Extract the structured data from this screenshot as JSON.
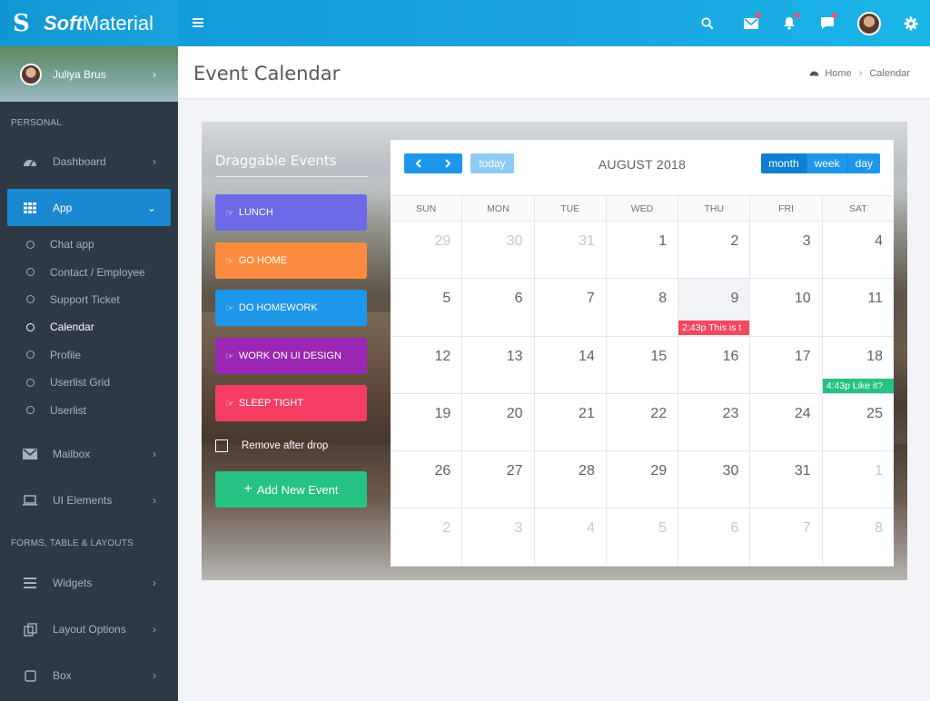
{
  "app": {
    "brand_bold": "Soft",
    "brand_rest": "Material"
  },
  "user": {
    "name": "Juliya Brus"
  },
  "sidebar": {
    "section_personal": "PERSONAL",
    "section_forms": "FORMS, TABLE & LAYOUTS",
    "items": {
      "dashboard": "Dashboard",
      "app": "App",
      "mailbox": "Mailbox",
      "ui_elements": "UI Elements",
      "widgets": "Widgets",
      "layout_options": "Layout Options",
      "box": "Box"
    },
    "app_sub": [
      "Chat app",
      "Contact / Employee",
      "Support Ticket",
      "Calendar",
      "Profile",
      "Userlist Grid",
      "Userlist"
    ]
  },
  "page": {
    "title": "Event Calendar",
    "breadcrumb_home": "Home",
    "breadcrumb_current": "Calendar"
  },
  "draggable": {
    "title": "Draggable Events",
    "events": [
      {
        "label": "LUNCH",
        "color": "#6b69e6"
      },
      {
        "label": "GO HOME",
        "color": "#fb8c3f"
      },
      {
        "label": "DO HOMEWORK",
        "color": "#1e96ea"
      },
      {
        "label": "WORK ON UI DESIGN",
        "color": "#9a28b4"
      },
      {
        "label": "SLEEP TIGHT",
        "color": "#f53d62"
      }
    ],
    "remove_after_drop": "Remove after drop",
    "add_button": "Add New Event"
  },
  "calendar": {
    "title": "AUGUST 2018",
    "today_label": "today",
    "views": [
      "month",
      "week",
      "day"
    ],
    "active_view": "month",
    "days_of_week": [
      "SUN",
      "MON",
      "TUE",
      "WED",
      "THU",
      "FRI",
      "SAT"
    ],
    "weeks": [
      [
        "29",
        "30",
        "31",
        "1",
        "2",
        "3",
        "4"
      ],
      [
        "5",
        "6",
        "7",
        "8",
        "9",
        "10",
        "11"
      ],
      [
        "12",
        "13",
        "14",
        "15",
        "16",
        "17",
        "18"
      ],
      [
        "19",
        "20",
        "21",
        "22",
        "23",
        "24",
        "25"
      ],
      [
        "26",
        "27",
        "28",
        "29",
        "30",
        "31",
        "1"
      ],
      [
        "2",
        "3",
        "4",
        "5",
        "6",
        "7",
        "8"
      ]
    ],
    "events": [
      {
        "text": "2:43p This is t",
        "color": "#f5475f",
        "date": "2018-08-09"
      },
      {
        "text": "4:43p Like it?",
        "color": "#26c281",
        "date": "2018-08-18"
      }
    ]
  }
}
